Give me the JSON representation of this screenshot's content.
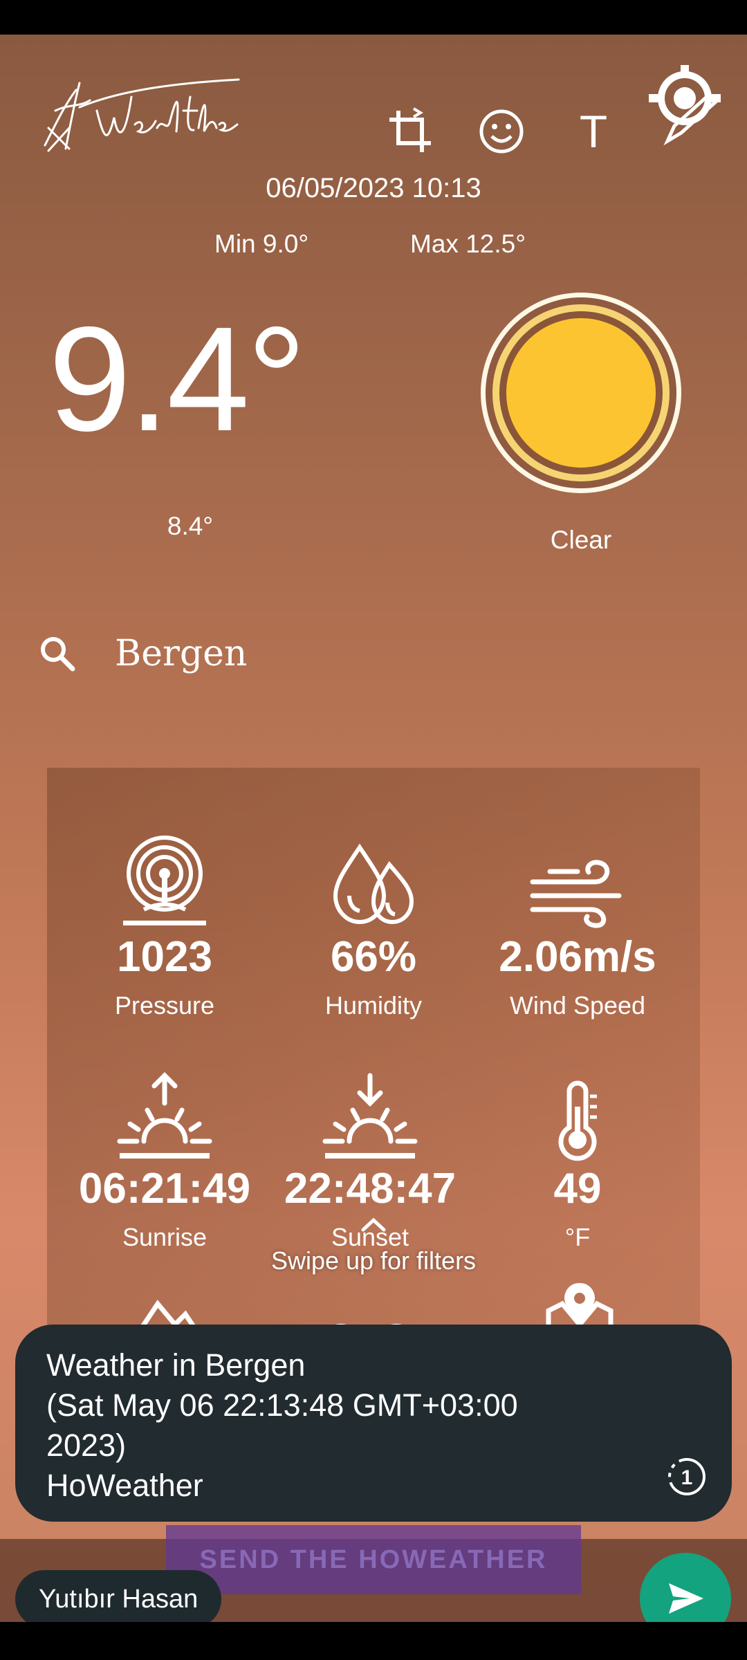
{
  "header": {
    "logo_text": "HoWeather",
    "tools": [
      {
        "name": "crop-rotate",
        "icon": "crop-icon"
      },
      {
        "name": "sticker",
        "icon": "smiley-icon"
      },
      {
        "name": "text",
        "icon": "text-icon",
        "label": "T"
      },
      {
        "name": "draw",
        "icon": "pencil-icon"
      }
    ]
  },
  "weather": {
    "datetime": "06/05/2023 10:13",
    "min": "Min 9.0°",
    "max": "Max 12.5°",
    "temperature": "9.4°",
    "feels_like": "8.4°",
    "condition": "Clear",
    "condition_icon": "sun-icon",
    "city": "Bergen"
  },
  "stats": [
    {
      "icon": "pressure-icon",
      "value": "1023",
      "label": "Pressure"
    },
    {
      "icon": "humidity-icon",
      "value": "66%",
      "label": "Humidity"
    },
    {
      "icon": "wind-icon",
      "value": "2.06m/s",
      "label": "Wind Speed"
    },
    {
      "icon": "sunrise-icon",
      "value": "06:21:49",
      "label": "Sunrise"
    },
    {
      "icon": "sunset-icon",
      "value": "22:48:47",
      "label": "Sunset"
    },
    {
      "icon": "thermometer-icon",
      "value": "49",
      "label": "°F"
    }
  ],
  "swipe_hint": "Swipe up for filters",
  "caption": {
    "text": "Weather in Bergen\n(Sat May 06 22:13:48 GMT+03:00\n2023)\nHoWeather",
    "view_once_icon": "view-once-icon",
    "view_once_label": "1"
  },
  "send_the_button": "SEND THE HOWEATHER",
  "recipient": "Yutıbır Hasan",
  "colors": {
    "sun_fill": "#fdc431",
    "send_fab": "#14a37f",
    "caption_bg": "#212b30"
  }
}
